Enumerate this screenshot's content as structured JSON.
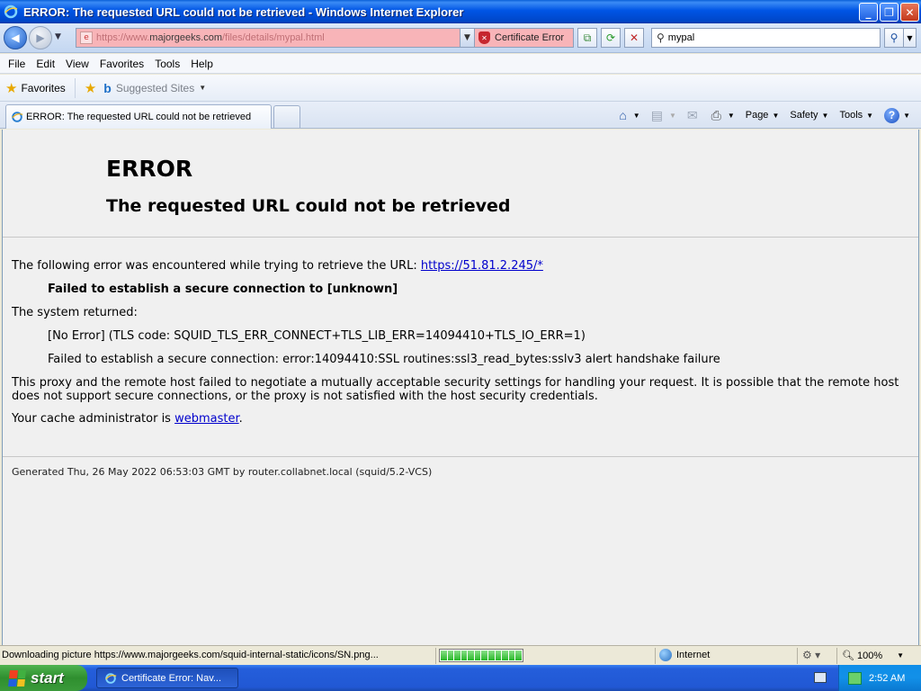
{
  "window": {
    "title": "ERROR: The requested URL could not be retrieved - Windows Internet Explorer",
    "min_label": "_",
    "max_label": "❐",
    "close_label": "✕"
  },
  "address": {
    "url_prefix": "https://www.",
    "url_domain": "majorgeeks.com",
    "url_suffix": "/files/details/mypal.html",
    "cert_error": "Certificate Error",
    "search_value": "mypal"
  },
  "menu": [
    "File",
    "Edit",
    "View",
    "Favorites",
    "Tools",
    "Help"
  ],
  "favorites": {
    "label": "Favorites",
    "suggested": "Suggested Sites"
  },
  "tab": {
    "title": "ERROR: The requested URL could not be retrieved"
  },
  "commands": {
    "page": "Page",
    "safety": "Safety",
    "tools": "Tools"
  },
  "page": {
    "heading": "ERROR",
    "subheading": "The requested URL could not be retrieved",
    "line1_prefix": "The following error was encountered while trying to retrieve the URL: ",
    "line1_link": "https://51.81.2.245/*",
    "line2": "Failed to establish a secure connection to [unknown]",
    "line3": "The system returned:",
    "line4": "[No Error] (TLS code: SQUID_TLS_ERR_CONNECT+TLS_LIB_ERR=14094410+TLS_IO_ERR=1)",
    "line5": "Failed to establish a secure connection: error:14094410:SSL routines:ssl3_read_bytes:sslv3 alert handshake failure",
    "line6": "This proxy and the remote host failed to negotiate a mutually acceptable security settings for handling your request. It is possible that the remote host does not support secure connections, or the proxy is not satisfied with the host security credentials.",
    "line7_prefix": "Your cache administrator is ",
    "line7_link": "webmaster",
    "line7_suffix": ".",
    "footer": "Generated Thu, 26 May 2022 06:53:03 GMT by router.collabnet.local (squid/5.2-VCS)"
  },
  "status": {
    "message": "Downloading picture https://www.majorgeeks.com/squid-internal-static/icons/SN.png...",
    "zone": "Internet",
    "zoom": "100%",
    "progress_segments": 12
  },
  "taskbar": {
    "start": "start",
    "item": "Certificate Error: Nav...",
    "clock": "2:52 AM"
  }
}
